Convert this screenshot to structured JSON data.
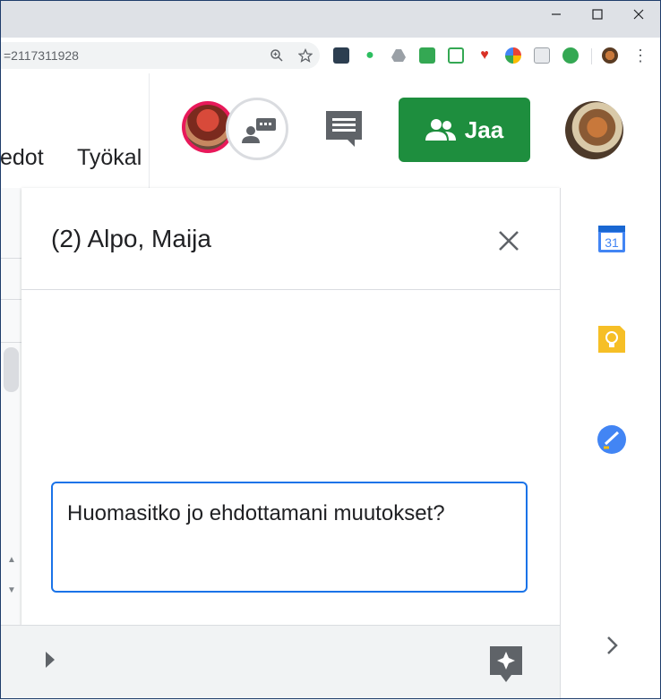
{
  "browser": {
    "url_fragment": "=2117311928",
    "extension_icons": [
      "dashlane-icon",
      "evernote-icon",
      "drive-icon",
      "translate-icon",
      "print-icon",
      "heart-icon",
      "chrome-color-icon",
      "cast-icon",
      "shield-check-icon"
    ]
  },
  "docs": {
    "menu": {
      "item_partial_1": "edot",
      "item_partial_2": "Työkal"
    },
    "share_label": "Jaa"
  },
  "chat": {
    "title": "(2) Alpo, Maija",
    "input_text": "Huomasitko jo ehdottamani muutokset?"
  },
  "side_panel": {
    "calendar_day": "31"
  },
  "colors": {
    "share_green": "#1e8e3e",
    "focus_blue": "#1a73e8",
    "keep_yellow": "#f6bf26"
  }
}
